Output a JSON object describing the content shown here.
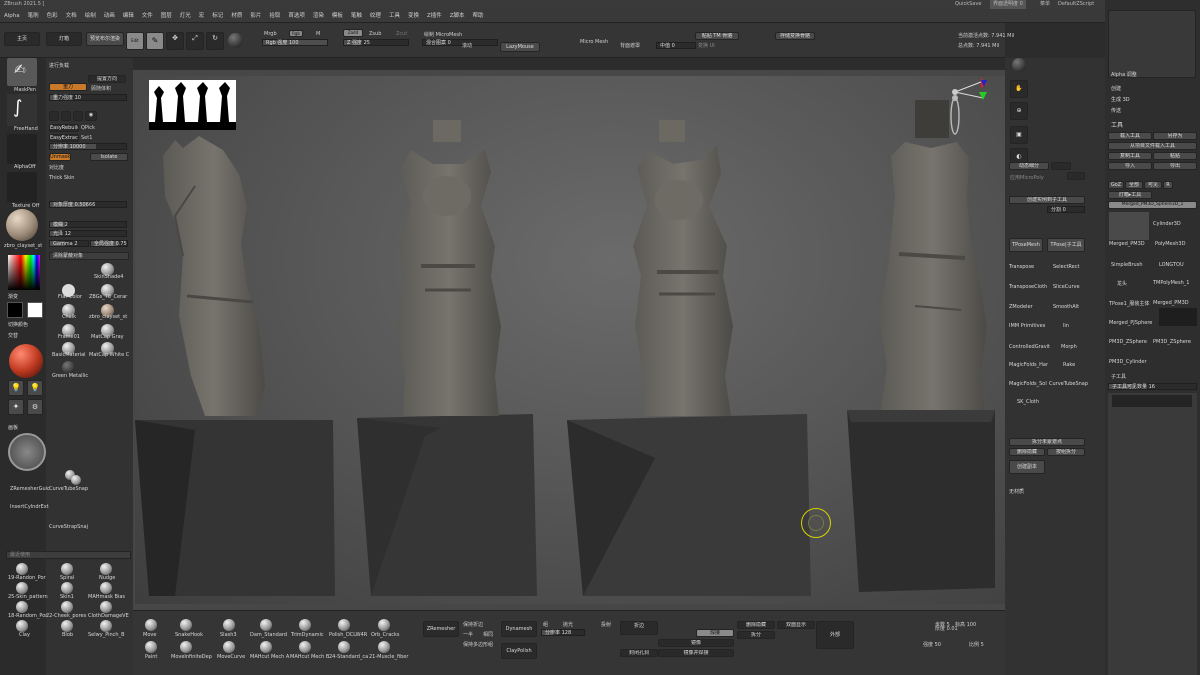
{
  "app": {
    "title": "ZBrush 2021.5 [",
    "quicksave": "QuickSave",
    "see_through": "界面透明度 0",
    "menus_btn": "菜单",
    "script": "DefaultZScript"
  },
  "menu": [
    "Alpha",
    "笔刷",
    "色彩",
    "文档",
    "绘制",
    "动画",
    "编辑",
    "文件",
    "图层",
    "灯光",
    "宏",
    "标记",
    "材质",
    "影片",
    "拾取",
    "首选项",
    "渲染",
    "模板",
    "笔触",
    "纹理",
    "工具",
    "变换",
    "Z插件",
    "Z脚本",
    "帮助"
  ],
  "topshelf": {
    "home": "主页",
    "lightbox": "灯箱",
    "preview_render": "预览布尔渲染",
    "edit": "Edit",
    "draw": "绘制",
    "move": "移动",
    "scale": "缩放",
    "rotate": "旋转",
    "mrgb": "Mrgb",
    "rgb": "Rgb",
    "m": "M",
    "rgb_intensity": "Rgb 强度 100",
    "zadd": "Zadd",
    "zsub": "Zsub",
    "zcut": "Zcut",
    "z_intensity": "Z 强度 25",
    "draw_micromesh": "绘制 MicroMesh",
    "mix_pattern": "混合图案 0",
    "lazy": "滚动",
    "lazymouse": "LazyMouse",
    "micromesh": "Micro Mesh",
    "bg_mask": "背面遮罩",
    "mask_val": "中值 0",
    "transfer": "变换 UI",
    "paste_tm": "粘贴 TM 骨骼",
    "store_tm": "存储变换骨骼",
    "active_points": "当前激活点数: 7.941 Mil",
    "total_points": "总点数: 7.941 Mil"
  },
  "left": {
    "maskpen": "MaskPen",
    "freehand": "FreeHand",
    "alphaoff": "AlphaOff",
    "textureoff": "Texture Off",
    "clayset": "zbro_clayset_st",
    "gradient": "渐变",
    "switch_color": "切换颜色",
    "alt": "交替",
    "matcap": "MatCap White C",
    "green_metal": "Green Metallic"
  },
  "brushpanel": {
    "title": "进行负载",
    "gravity": "重力",
    "gravity_strength": "重力强度 10",
    "easy_rebuild": "EasyRebuild",
    "qpick": "QPick",
    "easy_extract": "EasyExtract",
    "set1": "Set1",
    "res": "分辨率 10000",
    "unmask": "Unmask",
    "isolate": "Isolate",
    "thick_skin": "Thick Skin",
    "smooth": "对比度",
    "limit": "对象厚度 0.50666",
    "gamma": "Gamma 2",
    "global_strength": "全局强度 0.75",
    "mode": "模糊 2",
    "blur": "光泽 12",
    "clear_mask": "清除蒙蔽对象"
  },
  "materials": [
    {
      "name": "SkinShade4"
    },
    {
      "name": "Flat Color"
    },
    {
      "name": "ZBGs_T8_Cerar"
    },
    {
      "name": "Chalk"
    },
    {
      "name": "zbro_clayset_st"
    },
    {
      "name": "Frame01"
    },
    {
      "name": "MatCap Gray"
    },
    {
      "name": "BasicMaterial"
    },
    {
      "name": "MatCap White C"
    },
    {
      "name": "Green Metallic"
    }
  ],
  "leftbrushes": [
    {
      "name": "ZRemesherGuic"
    },
    {
      "name": "CurveTubeSnap"
    },
    {
      "name": "InsertCylndrExt"
    },
    {
      "name": "CurveStrapSnaj"
    },
    {
      "name": "19-Randon_Por"
    },
    {
      "name": "Spiral"
    },
    {
      "name": "Nudge"
    },
    {
      "name": "25-Skin_pattern"
    },
    {
      "name": "Skin1"
    },
    {
      "name": "MAHmask Bias"
    },
    {
      "name": "18-Random_Por"
    },
    {
      "name": "22-Cheek_pores"
    },
    {
      "name": "ClothDamageVE"
    },
    {
      "name": "Clay"
    },
    {
      "name": "Blob"
    },
    {
      "name": "Selwy_Pinch_B"
    }
  ],
  "bottombrushes": [
    {
      "name": "Move"
    },
    {
      "name": "SnakeHook"
    },
    {
      "name": "Slash3"
    },
    {
      "name": "Dam_Standard"
    },
    {
      "name": "TrimDynamic"
    },
    {
      "name": "Polish_DCLW4R"
    },
    {
      "name": "Orb_Cracks"
    },
    {
      "name": "Paint"
    },
    {
      "name": "MoveInfiniteDep"
    },
    {
      "name": "MoveCurve"
    },
    {
      "name": "MAHcut Mech A"
    },
    {
      "name": "MAHcut Mech B"
    },
    {
      "name": "24-Standard_ca"
    },
    {
      "name": "21-Muscle_fiber"
    }
  ],
  "bottomshelf": {
    "zremesher": "ZRemesher",
    "keep_groups": "保持折边",
    "one_half": "一半",
    "same": "相同",
    "keep_poly": "保持多边形组",
    "dynamesh": "Dynamesh",
    "groups": "组",
    "polish": "抛光",
    "resolution": "分辨率 128",
    "claypolish": "ClayPolish",
    "project": "投射",
    "weld": "焊接",
    "mirror": "镜像",
    "mirror_weld": "镜像并焊接",
    "crease": "折边",
    "delete_hidden": "删除隐藏",
    "dissolve": "拆分",
    "close_holes": "封闭孔洞",
    "double": "双面显示",
    "outer": "外部",
    "ao_val": "厚度 0.01",
    "strength": "强度 50",
    "count": "步数 5",
    "poly_count": "标高 100",
    "ratio": "比例 5"
  },
  "rightcol": {
    "zoom": "平移",
    "persp": "Persp",
    "floor": "Floor",
    "local": "Local",
    "xyz": "XYZ",
    "frame": "框选",
    "move": "移动",
    "scale": "缩放",
    "rotate": "旋转",
    "transp": "PolyF",
    "dynamic_sub": "动态细分",
    "apply_micropoly": "应用MicroPoly",
    "create_instance": "创建实例到子工具",
    "split": "分割 0",
    "tpose": "TPoseMesh",
    "tpose_sub": "TPose|子工具",
    "tools": [
      {
        "name": "Transpose"
      },
      {
        "name": "SelectRect"
      },
      {
        "name": "TransposeCloth"
      },
      {
        "name": "SliceCurve"
      },
      {
        "name": "ZModeler"
      },
      {
        "name": "SmoothAlt"
      },
      {
        "name": "IMM Primitives"
      },
      {
        "name": "lin"
      },
      {
        "name": "ControlledGravit"
      },
      {
        "name": "Morph"
      },
      {
        "name": "MagicFolds_Har"
      },
      {
        "name": "Rake"
      },
      {
        "name": "MagicFolds_Sol"
      },
      {
        "name": "CurveTubeSnap"
      },
      {
        "name": "SK_Cloth"
      }
    ],
    "split_groups": "拆分未蒙遮点",
    "delete_hidden": "删除隐藏",
    "group_split": "按组拆分",
    "create_copy": "创建副本",
    "no_material": "无材质"
  },
  "rightpanel": {
    "tool_title": "工具",
    "load": "载入工具",
    "save_as": "另存为",
    "import_from": "从项目文件载入工具",
    "copy": "复制工具",
    "paste": "粘贴",
    "import": "导入",
    "export": "导出",
    "goz": "GoZ",
    "all": "全部",
    "visible": "可见",
    "r": "R",
    "lightbox_tools": "灯箱▸工具",
    "current_tool": "Merged_PM3D_Sphere3D_1",
    "tools": [
      {
        "name": "Merged_PM3D"
      },
      {
        "name": "Cylinder3D"
      },
      {
        "name": "PolyMesh3D"
      },
      {
        "name": "SimpleBrush"
      },
      {
        "name": "LONGTOU"
      },
      {
        "name": "龙头"
      },
      {
        "name": "TMPolyMesh_1"
      },
      {
        "name": "TPose1_服装主体"
      },
      {
        "name": "Merged_PM3D"
      },
      {
        "name": "Merged_PJSphere"
      },
      {
        "name": "PM3D_ZSphere"
      },
      {
        "name": "PM3D_ZSphere"
      },
      {
        "name": "PM3D_Cylinder"
      }
    ],
    "subtool": "子工具",
    "subtool_count": "子工具可见数量 16",
    "brush_title": "笔刷",
    "generate": "生成 3D",
    "pass": "传送",
    "create": "创建",
    "alpha_adjust": "Alpha 调整"
  }
}
